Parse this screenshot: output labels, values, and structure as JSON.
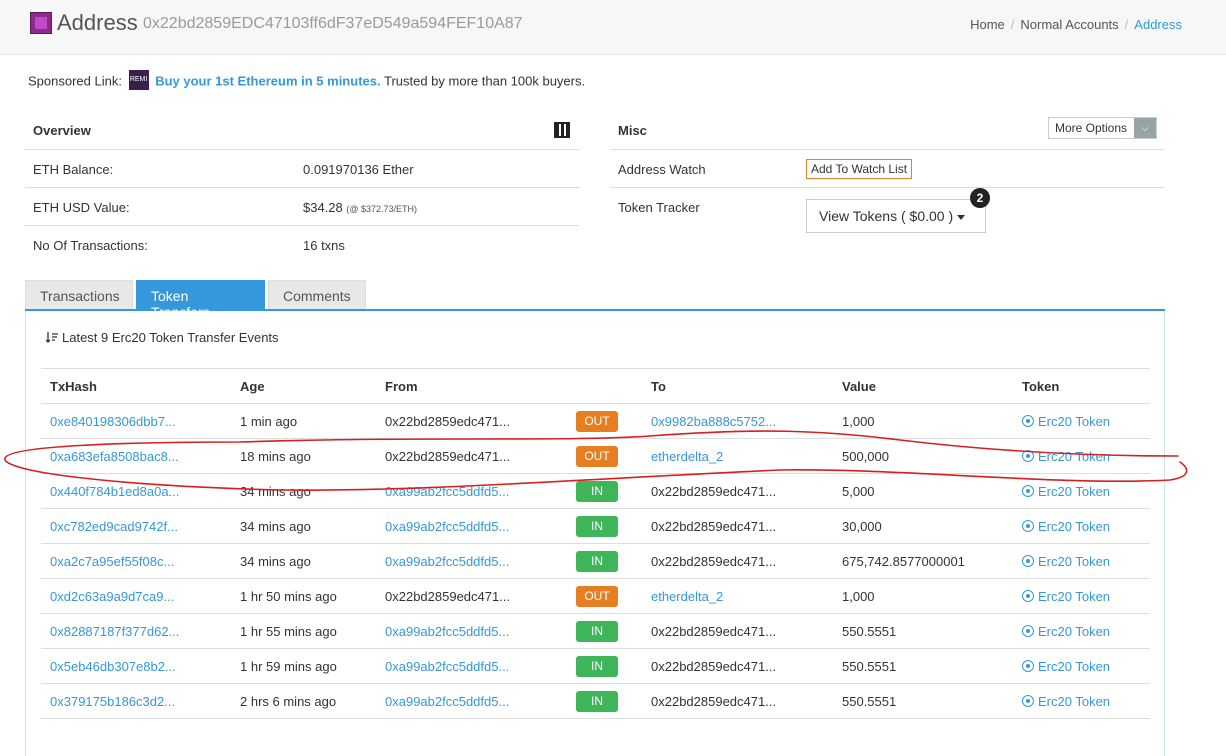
{
  "header": {
    "title": "Address",
    "address": "0x22bd2859EDC47103ff6dF37eD549a594FEF10A87",
    "breadcrumb": [
      "Home",
      "Normal Accounts",
      "Address"
    ]
  },
  "sponsored": {
    "prefix": "Sponsored Link:",
    "logo_text": "REMI",
    "link": "Buy your 1st Ethereum in 5 minutes.",
    "suffix": "Trusted by more than 100k buyers."
  },
  "overview": {
    "title": "Overview",
    "rows": [
      {
        "label": "ETH Balance:",
        "value": "0.091970136 Ether",
        "note": ""
      },
      {
        "label": "ETH USD Value:",
        "value": "$34.28",
        "note": "(@ $372.73/ETH)"
      },
      {
        "label": "No Of Transactions:",
        "value": "16 txns",
        "note": ""
      }
    ]
  },
  "misc": {
    "title": "Misc",
    "more_options": "More Options",
    "address_watch_label": "Address Watch",
    "watch_button": "Add To Watch List",
    "token_tracker_label": "Token Tracker",
    "view_tokens": "View Tokens ( $0.00 )",
    "token_badge": "2"
  },
  "tabs": [
    "Transactions",
    "Token Transfers",
    "Comments"
  ],
  "events_title": "Latest 9 Erc20 Token Transfer Events",
  "table": {
    "headers": [
      "TxHash",
      "Age",
      "From",
      "",
      "To",
      "Value",
      "Token"
    ],
    "rows": [
      {
        "hash": "0xe840198306dbb7...",
        "age": "1 min ago",
        "from": "0x22bd2859edc471...",
        "from_link": false,
        "dir": "OUT",
        "to": "0x9982ba888c5752...",
        "to_link": true,
        "value": "1,000",
        "token": "Erc20 Token"
      },
      {
        "hash": "0xa683efa8508bac8...",
        "age": "18 mins ago",
        "from": "0x22bd2859edc471...",
        "from_link": false,
        "dir": "OUT",
        "to": "etherdelta_2",
        "to_link": true,
        "value": "500,000",
        "token": "Erc20 Token"
      },
      {
        "hash": "0x440f784b1ed8a0a...",
        "age": "34 mins ago",
        "from": "0xa99ab2fcc5ddfd5...",
        "from_link": true,
        "dir": "IN",
        "to": "0x22bd2859edc471...",
        "to_link": false,
        "value": "5,000",
        "token": "Erc20 Token"
      },
      {
        "hash": "0xc782ed9cad9742f...",
        "age": "34 mins ago",
        "from": "0xa99ab2fcc5ddfd5...",
        "from_link": true,
        "dir": "IN",
        "to": "0x22bd2859edc471...",
        "to_link": false,
        "value": "30,000",
        "token": "Erc20 Token"
      },
      {
        "hash": "0xa2c7a95ef55f08c...",
        "age": "34 mins ago",
        "from": "0xa99ab2fcc5ddfd5...",
        "from_link": true,
        "dir": "IN",
        "to": "0x22bd2859edc471...",
        "to_link": false,
        "value": "675,742.8577000001",
        "token": "Erc20 Token"
      },
      {
        "hash": "0xd2c63a9a9d7ca9...",
        "age": "1 hr 50 mins ago",
        "from": "0x22bd2859edc471...",
        "from_link": false,
        "dir": "OUT",
        "to": "etherdelta_2",
        "to_link": true,
        "value": "1,000",
        "token": "Erc20 Token"
      },
      {
        "hash": "0x82887187f377d62...",
        "age": "1 hr 55 mins ago",
        "from": "0xa99ab2fcc5ddfd5...",
        "from_link": true,
        "dir": "IN",
        "to": "0x22bd2859edc471...",
        "to_link": false,
        "value": "550.5551",
        "token": "Erc20 Token"
      },
      {
        "hash": "0x5eb46db307e8b2...",
        "age": "1 hr 59 mins ago",
        "from": "0xa99ab2fcc5ddfd5...",
        "from_link": true,
        "dir": "IN",
        "to": "0x22bd2859edc471...",
        "to_link": false,
        "value": "550.5551",
        "token": "Erc20 Token"
      },
      {
        "hash": "0x379175b186c3d2...",
        "age": "2 hrs 6 mins ago",
        "from": "0xa99ab2fcc5ddfd5...",
        "from_link": true,
        "dir": "IN",
        "to": "0x22bd2859edc471...",
        "to_link": false,
        "value": "550.5551",
        "token": "Erc20 Token"
      }
    ]
  },
  "colors": {
    "link": "#3498db",
    "out_badge": "#e67e22",
    "in_badge": "#3fb55a",
    "annotation": "#d62020"
  }
}
